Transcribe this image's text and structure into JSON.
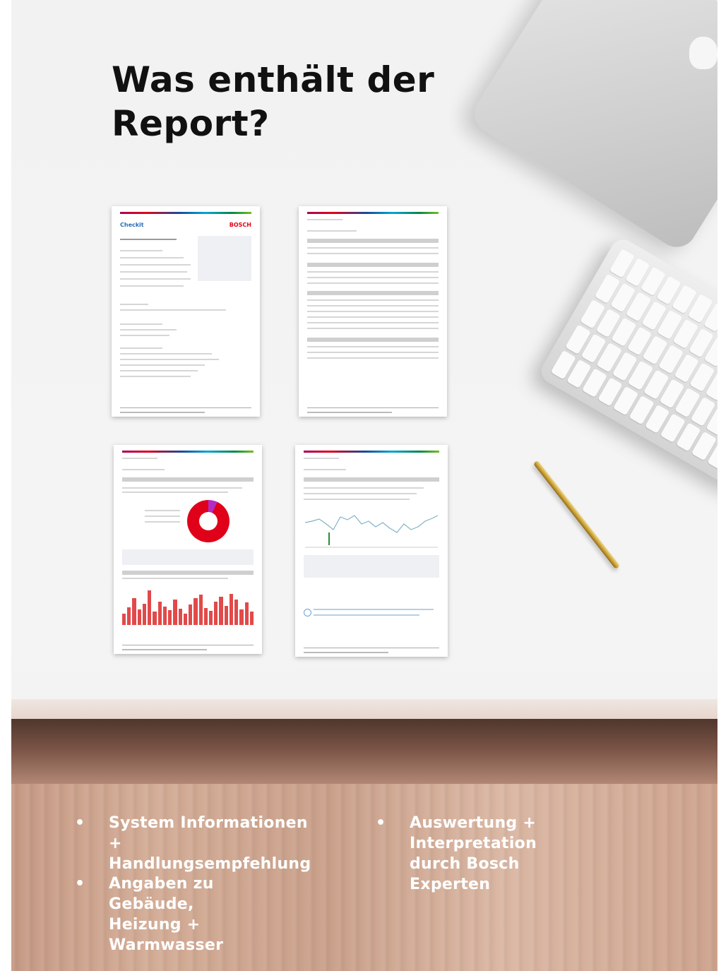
{
  "heading": {
    "line1": "Was enthält der",
    "line2": "Report?"
  },
  "thumbnails": {
    "page1_brand_left": "Checkit",
    "page1_brand_right": "BOSCH"
  },
  "bullets": [
    {
      "line1": "System Informationen +",
      "line2": "Handlungsempfehlung"
    },
    {
      "line1": "Angaben zu Gebäude,",
      "line2": "Heizung + Warmwasser"
    },
    {
      "line1": "Auswertung + Interpretation",
      "line2": "durch Bosch Experten"
    }
  ],
  "bullet_symbol": "•",
  "colors": {
    "title": "#111111",
    "bullet_text": "#ffffff",
    "bosch_red": "#e2001a",
    "checkit_blue": "#2a6eb5"
  }
}
